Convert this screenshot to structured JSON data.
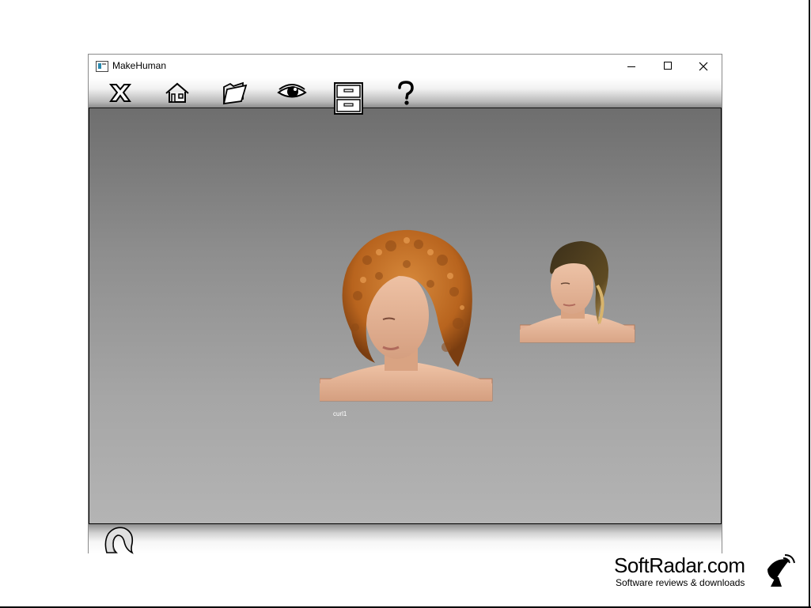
{
  "window": {
    "title": "MakeHuman",
    "controls": [
      "minimize",
      "maximize",
      "close"
    ]
  },
  "toolbar": {
    "tools": [
      {
        "name": "exit",
        "icon": "close-x-icon"
      },
      {
        "name": "home",
        "icon": "home-icon"
      },
      {
        "name": "load",
        "icon": "folder-icon"
      },
      {
        "name": "view",
        "icon": "eye-icon"
      },
      {
        "name": "library",
        "icon": "file-cabinet-icon",
        "active": true
      },
      {
        "name": "help",
        "icon": "question-mark-icon"
      }
    ]
  },
  "viewport": {
    "items": [
      {
        "label": "curl1",
        "selected": true
      },
      {
        "label": ""
      }
    ]
  },
  "statusbar": {
    "icon": "hair-icon"
  },
  "watermark": {
    "name": "SoftRadar.com",
    "tagline": "Software reviews & downloads",
    "icon": "satellite-dish-icon"
  }
}
